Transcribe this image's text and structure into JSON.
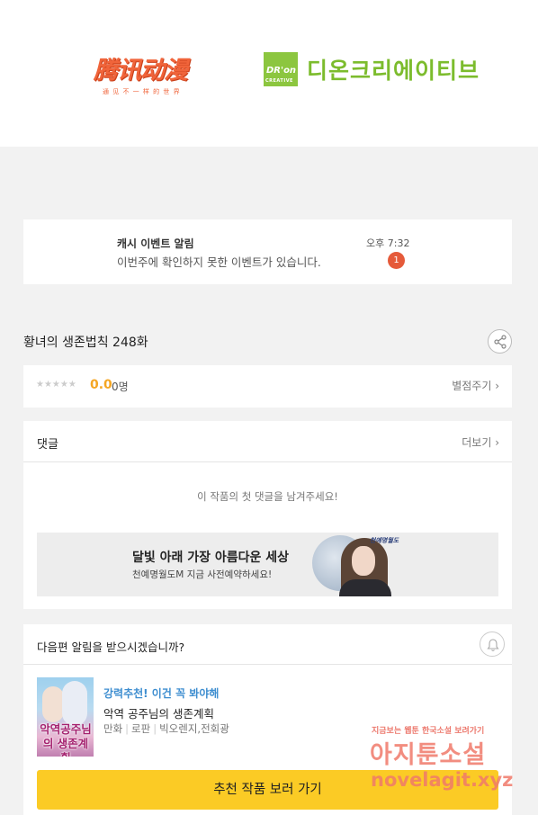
{
  "header": {
    "logo_left_main": "腾讯动漫",
    "logo_left_sub": "通 见 不 一 样 的 世 界",
    "logo_right_mark_top": "DR'on",
    "logo_right_mark_bottom": "CREATIVE",
    "logo_right_name": "디온크리에이티브"
  },
  "notification": {
    "title": "캐시 이벤트 알림",
    "message": "이번주에 확인하지 못한 이벤트가 있습니다.",
    "time": "오후 7:32",
    "badge": "1"
  },
  "episode": {
    "title": "황녀의 생존법칙 248화",
    "share_icon": "share-icon"
  },
  "rating": {
    "stars": "★★★★★",
    "score": "0.0",
    "count": "0명",
    "give_label": "별점주기 ›",
    "star_value": 0
  },
  "comments": {
    "title": "댓글",
    "more_label": "더보기 ›",
    "empty_message": "이 작품의 첫 댓글을 남겨주세요!",
    "banner": {
      "title": "달빛 아래 가장 아름다운 세상",
      "subtitle": "천예명월도M 지금 사전예약하세요!",
      "logo": "천예명월도"
    }
  },
  "next_episode": {
    "question": "다음편 알림을 받으시겠습니까?",
    "bell_icon": "bell-icon",
    "recommend": {
      "thumbnail_title": "악역공주님의 생존계획",
      "label": "강력추천! 이건 꼭 봐야해",
      "title": "악역 공주님의 생존계획",
      "genre1": "만화",
      "genre2": "로판",
      "authors": "빅오렌지,전회광"
    },
    "button_label": "추천 작품 보러 가기"
  },
  "watermark": {
    "line1": "지금보는 웹툰 한국소설 보려가기",
    "line2": "아지툰소설",
    "line3": "novelagit.xyz"
  },
  "colors": {
    "accent_yellow": "#fbcb25",
    "score_orange": "#f5a623",
    "badge_red": "#e55a3a",
    "recommend_blue": "#3e8ed0"
  }
}
